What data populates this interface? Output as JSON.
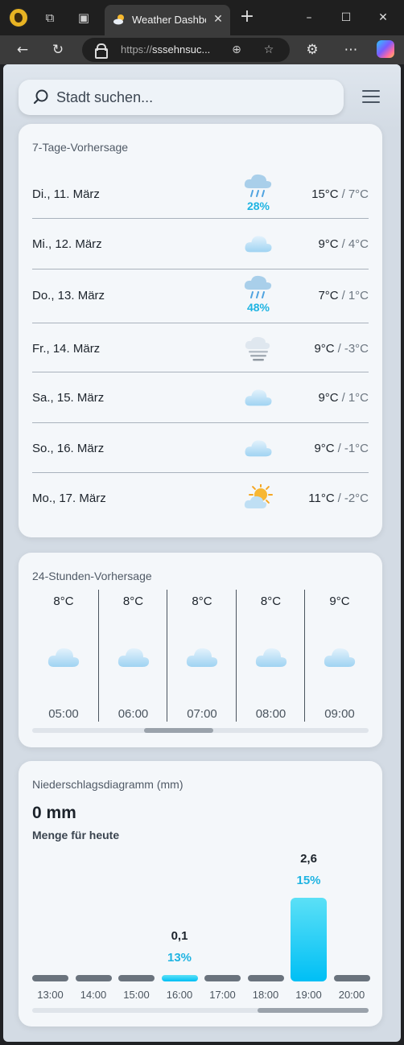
{
  "browser": {
    "tab_title": "Weather Dashboard",
    "url_protocol": "https://",
    "url_host": "sssehnsuc...",
    "icons": [
      "workspaces-icon",
      "tab-actions-icon",
      "back-icon",
      "reload-icon",
      "zoom-icon",
      "favorite-icon",
      "extensions-icon",
      "more-icon",
      "copilot-icon"
    ]
  },
  "search": {
    "placeholder": "Stadt suchen..."
  },
  "forecast7": {
    "title": "7-Tage-Vorhersage",
    "days": [
      {
        "name": "Di., 11. März",
        "high": "15°C",
        "low": "7°C",
        "icon": "rain-cloud",
        "pop": "28%"
      },
      {
        "name": "Mi., 12. März",
        "high": "9°C",
        "low": "4°C",
        "icon": "cloud",
        "pop": ""
      },
      {
        "name": "Do., 13. März",
        "high": "7°C",
        "low": "1°C",
        "icon": "rain-cloud",
        "pop": "48%"
      },
      {
        "name": "Fr., 14. März",
        "high": "9°C",
        "low": "-3°C",
        "icon": "fog",
        "pop": ""
      },
      {
        "name": "Sa., 15. März",
        "high": "9°C",
        "low": "1°C",
        "icon": "cloud",
        "pop": ""
      },
      {
        "name": "So., 16. März",
        "high": "9°C",
        "low": "-1°C",
        "icon": "cloud",
        "pop": ""
      },
      {
        "name": "Mo., 17. März",
        "high": "11°C",
        "low": "-2°C",
        "icon": "sun-cloud",
        "pop": ""
      }
    ],
    "temp_separator": "/"
  },
  "forecast24": {
    "title": "24-Stunden-Vorhersage",
    "hours": [
      {
        "temp": "8°C",
        "time": "05:00",
        "icon": "cloud"
      },
      {
        "temp": "8°C",
        "time": "06:00",
        "icon": "cloud"
      },
      {
        "temp": "8°C",
        "time": "07:00",
        "icon": "cloud"
      },
      {
        "temp": "8°C",
        "time": "08:00",
        "icon": "cloud"
      },
      {
        "temp": "9°C",
        "time": "09:00",
        "icon": "cloud"
      }
    ]
  },
  "precip": {
    "title": "Niederschlagsdiagramm (mm)",
    "total": "0 mm",
    "subtitle": "Menge für heute",
    "accent": "#1fb4e2"
  },
  "chart_data": {
    "type": "bar",
    "title": "Niederschlagsdiagramm (mm)",
    "categories": [
      "13:00",
      "14:00",
      "15:00",
      "16:00",
      "17:00",
      "18:00",
      "19:00",
      "20:00"
    ],
    "values": [
      0,
      0,
      0,
      0.1,
      0,
      0,
      2.6,
      0
    ],
    "value_labels": [
      "",
      "",
      "",
      "0,1",
      "",
      "",
      "2,6",
      ""
    ],
    "probabilities": [
      "",
      "",
      "",
      "13%",
      "",
      "",
      "15%",
      ""
    ],
    "ylim": [
      0,
      2.6
    ],
    "grid": false
  }
}
